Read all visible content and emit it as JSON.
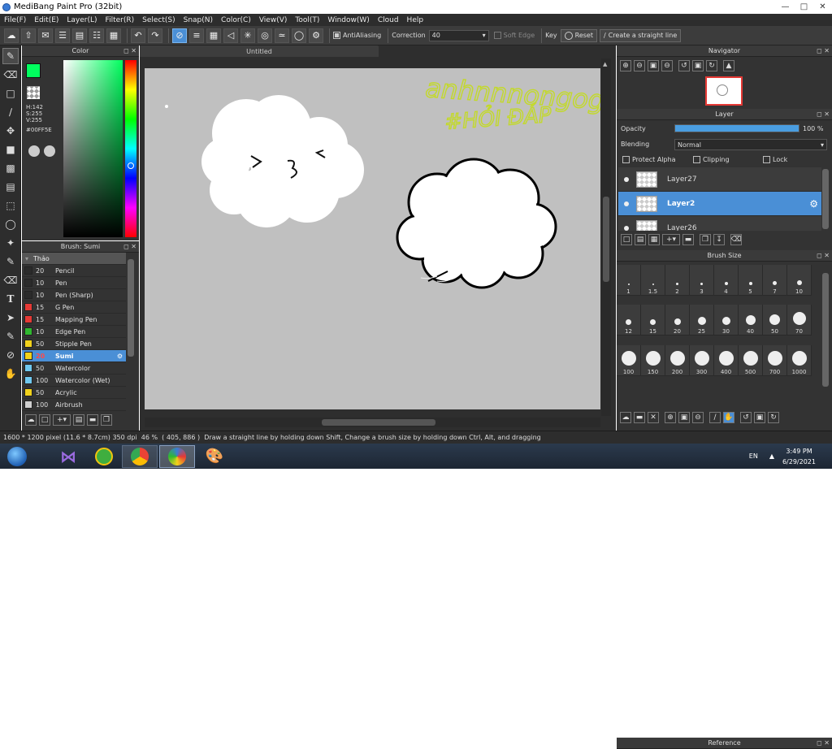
{
  "window": {
    "title": "MediBang Paint Pro (32bit)"
  },
  "menu": [
    "File(F)",
    "Edit(E)",
    "Layer(L)",
    "Filter(R)",
    "Select(S)",
    "Snap(N)",
    "Color(C)",
    "View(V)",
    "Tool(T)",
    "Window(W)",
    "Cloud",
    "Help"
  ],
  "toolbar": {
    "antialiasing": "AntiAliasing",
    "correction_label": "Correction",
    "correction_value": "40",
    "soft_edge": "Soft Edge",
    "key": "Key",
    "reset": "Reset",
    "straight_line": "Create a straight line"
  },
  "color_panel": {
    "title": "Color",
    "h": "H:142",
    "s": "S:255",
    "v": "V:255",
    "hex": "#00FF5E",
    "fg_color": "#00FF5E"
  },
  "brush_panel": {
    "title": "Brush: Sumi",
    "group": "Thảo",
    "brushes": [
      {
        "size": "20",
        "name": "Pencil",
        "color": "#2b2b2b"
      },
      {
        "size": "10",
        "name": "Pen",
        "color": "#2b2b2b"
      },
      {
        "size": "10",
        "name": "Pen (Sharp)",
        "color": "#2b2b2b"
      },
      {
        "size": "15",
        "name": "G Pen",
        "color": "#e53935"
      },
      {
        "size": "15",
        "name": "Mapping Pen",
        "color": "#e53935"
      },
      {
        "size": "10",
        "name": "Edge Pen",
        "color": "#2fb82f"
      },
      {
        "size": "50",
        "name": "Stipple Pen",
        "color": "#f2d21b"
      },
      {
        "size": "20",
        "name": "Sumi",
        "color": "#f2d21b",
        "selected": true
      },
      {
        "size": "50",
        "name": "Watercolor",
        "color": "#6fc8f0"
      },
      {
        "size": "100",
        "name": "Watercolor (Wet)",
        "color": "#6fc8f0"
      },
      {
        "size": "50",
        "name": "Acrylic",
        "color": "#f2d21b"
      },
      {
        "size": "100",
        "name": "Airbrush",
        "color": "#cfcfcf"
      }
    ]
  },
  "canvas": {
    "tab": "Untitled",
    "handwriting_1": "anhnnnongogs",
    "handwriting_2": "#HỎI ĐÁP",
    "face": "> 3 <"
  },
  "navigator": {
    "title": "Navigator"
  },
  "layer_panel": {
    "title": "Layer",
    "opacity_label": "Opacity",
    "opacity_value": "100 %",
    "opacity": 1.0,
    "blending_label": "Blending",
    "blending_value": "Normal",
    "protect_alpha": "Protect Alpha",
    "clipping": "Clipping",
    "lock": "Lock",
    "layers": [
      {
        "name": "Layer27",
        "selected": false
      },
      {
        "name": "Layer2",
        "selected": true
      },
      {
        "name": "Layer26",
        "selected": false
      }
    ]
  },
  "brush_size_panel": {
    "title": "Brush Size",
    "sizes": [
      "1",
      "1.5",
      "2",
      "3",
      "4",
      "5",
      "7",
      "10",
      "12",
      "15",
      "20",
      "25",
      "30",
      "40",
      "50",
      "70",
      "100",
      "150",
      "200",
      "300",
      "400",
      "500",
      "700",
      "1000"
    ]
  },
  "reference": {
    "title": "Reference"
  },
  "status": {
    "size": "1600 * 1200 pixel",
    "cm": "(11.6 * 8.7cm)",
    "dpi": "350 dpi",
    "zoom": "46 %",
    "coords": "( 405, 886 )",
    "hint": "Draw a straight line by holding down Shift, Change a brush size by holding down Ctrl, Alt, and dragging"
  },
  "taskbar": {
    "lang": "EN",
    "time": "3:49 PM",
    "date": "6/29/2021"
  }
}
